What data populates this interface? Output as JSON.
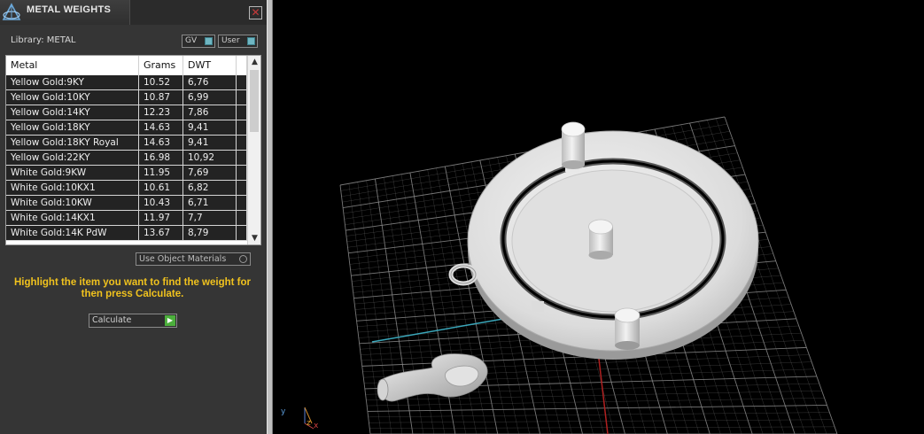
{
  "panel": {
    "title": "METAL WEIGHTS",
    "close_glyph": "✕",
    "library_label": "Library: METAL",
    "toggles": [
      {
        "label": "GV",
        "icon": "toggle-icon"
      },
      {
        "label": "User",
        "icon": "toggle-icon"
      }
    ],
    "table": {
      "columns": [
        "Metal",
        "Grams",
        "DWT"
      ],
      "rows": [
        [
          "Yellow Gold:9KY",
          "10.52",
          "6,76"
        ],
        [
          "Yellow Gold:10KY",
          "10.87",
          "6,99"
        ],
        [
          "Yellow Gold:14KY",
          "12.23",
          "7,86"
        ],
        [
          "Yellow Gold:18KY",
          "14.63",
          "9,41"
        ],
        [
          "Yellow Gold:18KY Royal",
          "14.63",
          "9,41"
        ],
        [
          "Yellow Gold:22KY",
          "16.98",
          "10,92"
        ],
        [
          "White Gold:9KW",
          "11.95",
          "7,69"
        ],
        [
          "White Gold:10KX1",
          "10.61",
          "6,82"
        ],
        [
          "White Gold:10KW",
          "10.43",
          "6,71"
        ],
        [
          "White Gold:14KX1",
          "11.97",
          "7,7"
        ],
        [
          "White Gold:14K PdW",
          "13.67",
          "8,79"
        ]
      ]
    },
    "use_object_materials": "Use Object Materials",
    "instructions": "Highlight the item you want to find the weight for then press Calculate.",
    "calculate_label": "Calculate",
    "calculate_arrow": "▶"
  },
  "viewport": {
    "axis_y": "y",
    "axis_z": "z",
    "axis_x": "x",
    "colors": {
      "grid": "#8c8c8c",
      "axis_x": "#3aa6b9",
      "axis_y": "#b02020",
      "model": "#e6e6e6"
    }
  }
}
